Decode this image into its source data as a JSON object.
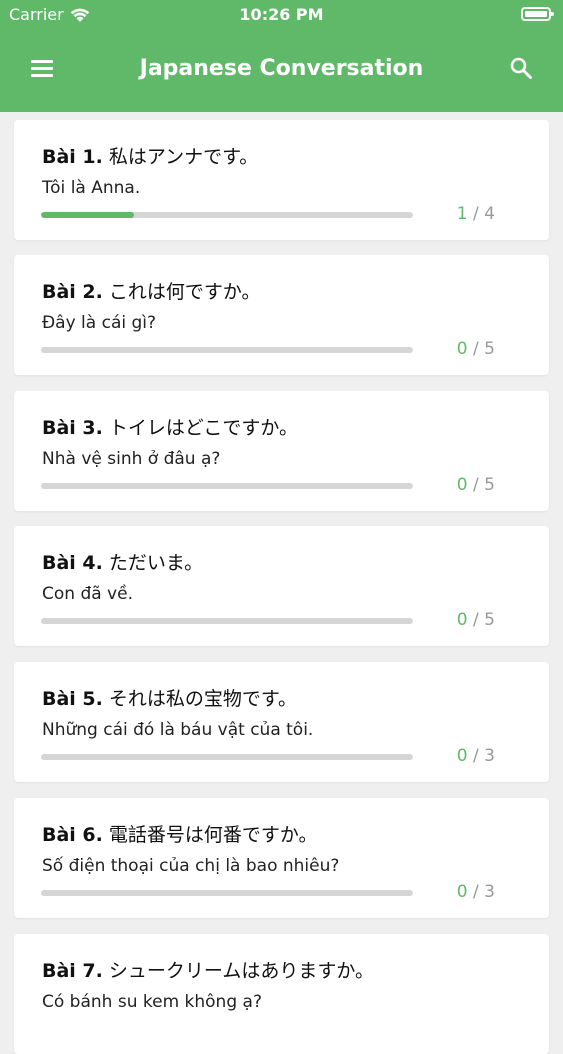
{
  "status_bar": {
    "carrier": "Carrier",
    "time": "10:26 PM"
  },
  "header": {
    "title": "Japanese Conversation"
  },
  "colors": {
    "accent": "#5fb968",
    "track": "#d6d6d6",
    "background": "#efefef"
  },
  "lessons": [
    {
      "num": "Bài 1.",
      "jp": "私はアンナです。",
      "vi": "Tôi là Anna.",
      "done": "1",
      "total": "4",
      "progress": 0.25
    },
    {
      "num": "Bài 2.",
      "jp": "これは何ですか。",
      "vi": "Đây là cái gì?",
      "done": "0",
      "total": "5",
      "progress": 0
    },
    {
      "num": "Bài 3.",
      "jp": "トイレはどこですか。",
      "vi": "Nhà vệ sinh ở đâu ạ?",
      "done": "0",
      "total": "5",
      "progress": 0
    },
    {
      "num": "Bài 4.",
      "jp": "ただいま。",
      "vi": "Con đã về.",
      "done": "0",
      "total": "5",
      "progress": 0
    },
    {
      "num": "Bài 5.",
      "jp": "それは私の宝物です。",
      "vi": "Những cái đó là báu vật của tôi.",
      "done": "0",
      "total": "3",
      "progress": 0
    },
    {
      "num": "Bài 6.",
      "jp": "電話番号は何番ですか。",
      "vi": "Số điện thoại của chị là bao nhiêu?",
      "done": "0",
      "total": "3",
      "progress": 0
    },
    {
      "num": "Bài 7.",
      "jp": "シュークリームはありますか。",
      "vi": "Có bánh su kem không ạ?",
      "done": "",
      "total": "",
      "progress": 0
    }
  ]
}
